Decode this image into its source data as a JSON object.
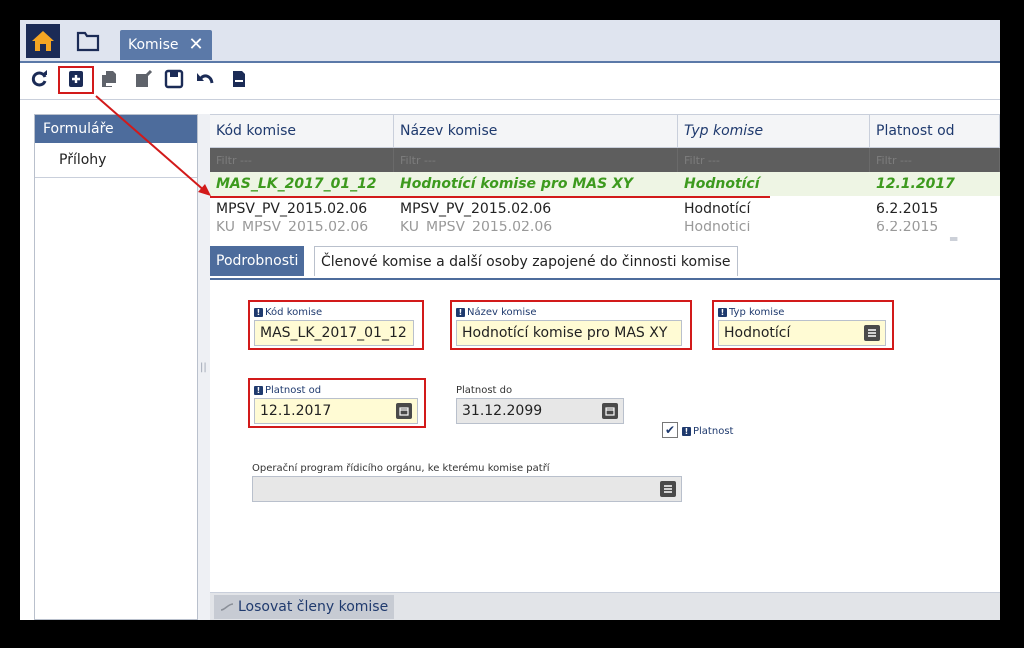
{
  "tab": {
    "label": "Komise",
    "close": "✕"
  },
  "left_panel": {
    "header": "Formuláře",
    "items": [
      {
        "label": "Přílohy"
      }
    ]
  },
  "grid": {
    "columns": [
      {
        "label": "Kód komise"
      },
      {
        "label": "Název komise"
      },
      {
        "label": "Typ komise"
      },
      {
        "label": "Platnost od"
      }
    ],
    "filter_placeholder": "Filtr ---",
    "rows": [
      [
        "MAS_LK_2017_01_12",
        "Hodnotící komise pro MAS XY",
        "Hodnotící",
        "12.1.2017"
      ],
      [
        "MPSV_PV_2015.02.06",
        "MPSV_PV_2015.02.06",
        "Hodnotící",
        "6.2.2015"
      ],
      [
        "KÚ_MPSV_2015.02.06",
        "KÚ_MPSV_2015.02.06",
        "Hodnotící",
        "6.2.2015"
      ]
    ]
  },
  "detail_tabs": [
    {
      "label": "Podrobnosti"
    },
    {
      "label": "Členové komise a další osoby zapojené do činnosti komise"
    }
  ],
  "form": {
    "kod": {
      "label": "Kód komise",
      "value": "MAS_LK_2017_01_12"
    },
    "nazev": {
      "label": "Název komise",
      "value": "Hodnotící komise pro MAS XY"
    },
    "typ": {
      "label": "Typ komise",
      "value": "Hodnotící"
    },
    "platnost_od": {
      "label": "Platnost od",
      "value": "12.1.2017"
    },
    "platnost_do": {
      "label": "Platnost do",
      "value": "31.12.2099"
    },
    "platnost": {
      "label": "Platnost",
      "checked": true
    },
    "op": {
      "label": "Operační program řídicího orgánu, ke kterému komise patří",
      "value": ""
    }
  },
  "bottom": {
    "losovat": "Losovat členy komise"
  },
  "colors": {
    "accent": "#4d6c9c",
    "highlight": "#d21a1a",
    "selected_text": "#3d9a1e",
    "field_bg": "#fffbd4"
  }
}
